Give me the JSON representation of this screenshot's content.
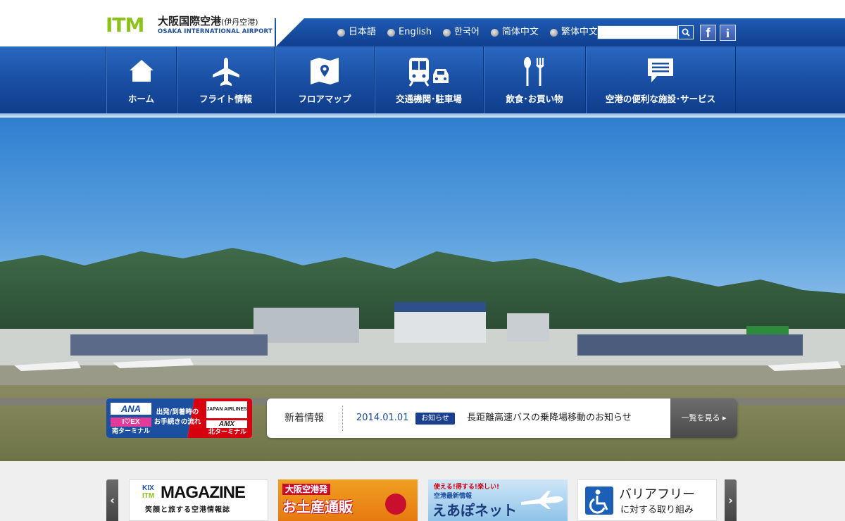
{
  "header": {
    "logo_mark": "ITM",
    "logo_name_jp": "大阪国際空港",
    "logo_name_jp_sub": "(伊丹空港)",
    "logo_name_en": "OSAKA INTERNATIONAL AIRPORT",
    "languages": [
      "日本語",
      "English",
      "한국어",
      "简体中文",
      "繁体中文"
    ],
    "search": {
      "value": "",
      "placeholder": ""
    },
    "facebook_label": "f",
    "info_label": "i"
  },
  "nav": {
    "items": [
      {
        "label": "ホーム",
        "icon": "home-icon"
      },
      {
        "label": "フライト情報",
        "icon": "airplane-icon"
      },
      {
        "label": "フロアマップ",
        "icon": "map-icon"
      },
      {
        "label": "交通機関･駐車場",
        "icon": "train-car-icon"
      },
      {
        "label": "飲食･お買い物",
        "icon": "fork-spoon-icon"
      },
      {
        "label": "空港の便利な施設･サービス",
        "icon": "speech-bubble-icon"
      }
    ]
  },
  "terminal_banner": {
    "ana_logo": "ANA",
    "iex_logo": "I♡EX",
    "south_label": "南ターミナル",
    "center_line1": "出発/到着時の",
    "center_line2": "お手続きの流れ",
    "jal_logo": "JAPAN AIRLINES",
    "amx_logo": "AMX",
    "north_label": "北ターミナル"
  },
  "news": {
    "heading": "新着情報",
    "date": "2014.01.01",
    "badge": "お知らせ",
    "title": "長距離高速バスの乗降場移動のお知らせ",
    "more_label": "一覧を見る ▸"
  },
  "banners": {
    "magazine": {
      "kix": "KIX",
      "itm": "ITM",
      "title": "MAGAZINE",
      "sub": "笑顔と旅する空港情報誌"
    },
    "shop": {
      "line1": "大阪空港発",
      "line2": "お土産通販"
    },
    "eapo": {
      "line1": "使える!得する!楽しい!",
      "line2": "空港最新情報",
      "title": "えあぽネット"
    },
    "barrier": {
      "line1": "バリアフリー",
      "line2": "に対する取り組み"
    }
  },
  "carousel": {
    "prev": "‹",
    "next": "›"
  },
  "colors": {
    "brand_blue": "#1a4fa3",
    "logo_green": "#8bc21c",
    "jal_red": "#d7000f",
    "ana_blue": "#1c4fa0"
  }
}
